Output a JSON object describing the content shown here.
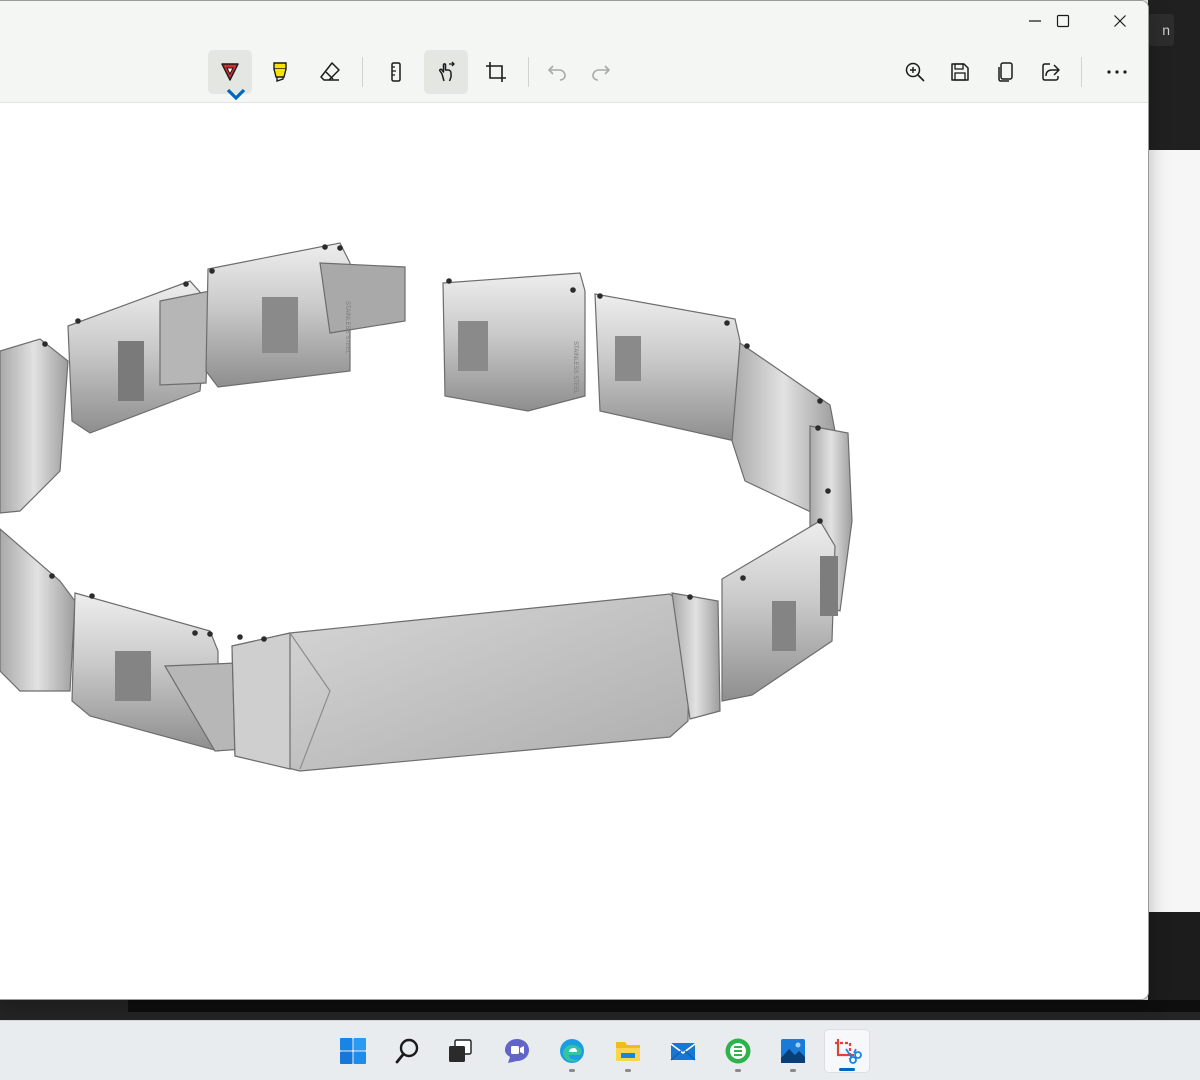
{
  "app": {
    "name": "Snipping Tool"
  },
  "background_window": {
    "button_text": "n"
  },
  "window_controls": [
    {
      "name": "minimize-button",
      "icon": "minimize-icon"
    },
    {
      "name": "maximize-button",
      "icon": "maximize-icon"
    },
    {
      "name": "close-button",
      "icon": "close-icon"
    }
  ],
  "toolbar": {
    "tools": [
      {
        "name": "ballpoint-pen-tool",
        "icon": "ballpoint-pen-icon",
        "color": "#d32f2f",
        "active": true
      },
      {
        "name": "highlighter-tool",
        "icon": "highlighter-icon",
        "color": "#f5e400"
      },
      {
        "name": "eraser-tool",
        "icon": "eraser-icon"
      },
      {
        "name": "ruler-tool",
        "icon": "ruler-icon"
      },
      {
        "name": "touch-writing-tool",
        "icon": "touch-writing-icon",
        "active": true
      },
      {
        "name": "crop-tool",
        "icon": "crop-icon"
      },
      {
        "name": "undo-button",
        "icon": "undo-icon",
        "disabled": true
      },
      {
        "name": "redo-button",
        "icon": "redo-icon",
        "disabled": true
      },
      {
        "name": "zoom-button",
        "icon": "zoom-in-icon"
      },
      {
        "name": "save-button",
        "icon": "save-icon"
      },
      {
        "name": "copy-button",
        "icon": "copy-icon"
      },
      {
        "name": "share-button",
        "icon": "share-icon"
      },
      {
        "name": "more-options-button",
        "icon": "more-icon"
      }
    ]
  },
  "canvas": {
    "content": "stainless-steel-link-bracelet-image",
    "engraving_text": "STAINLESS STEEL"
  },
  "taskbar": {
    "items": [
      {
        "name": "start",
        "icon": "windows-logo-icon"
      },
      {
        "name": "search",
        "icon": "search-icon"
      },
      {
        "name": "task-view",
        "icon": "task-view-icon"
      },
      {
        "name": "chat",
        "icon": "chat-icon"
      },
      {
        "name": "edge",
        "icon": "edge-icon",
        "running": true
      },
      {
        "name": "file-explorer",
        "icon": "folder-icon",
        "running": true
      },
      {
        "name": "mail",
        "icon": "mail-icon"
      },
      {
        "name": "app-green",
        "icon": "green-app-icon",
        "running": true
      },
      {
        "name": "photos",
        "icon": "photos-icon",
        "running": true
      },
      {
        "name": "snipping-tool",
        "icon": "snipping-tool-icon",
        "running": true,
        "active": true
      }
    ]
  },
  "colors": {
    "accent": "#0067c0",
    "titlebar": "#f3f6f2",
    "taskbar": "#e9ecef"
  }
}
